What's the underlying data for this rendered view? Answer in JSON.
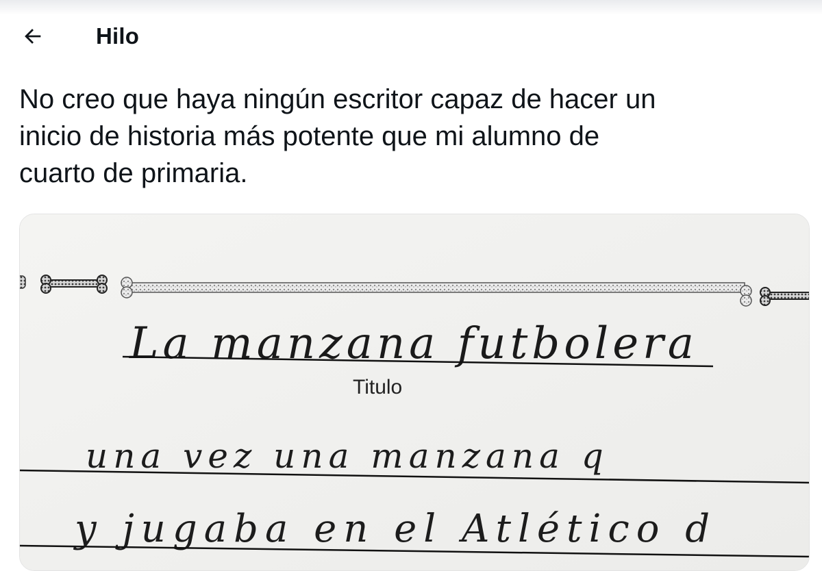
{
  "header": {
    "title": "Hilo",
    "back_icon": "arrow-left-icon"
  },
  "post": {
    "text_lines": [
      "No creo que haya ningún escritor capaz de hacer un",
      "inicio de historia más potente que mi alumno de",
      "cuarto de primaria."
    ]
  },
  "media": {
    "handwritten_title": "La manzana futbolera",
    "printed_label": "Titulo",
    "handwritten_line_1": "una vez una manzana q",
    "handwritten_line_2": "y jugaba en el Atlético d"
  }
}
